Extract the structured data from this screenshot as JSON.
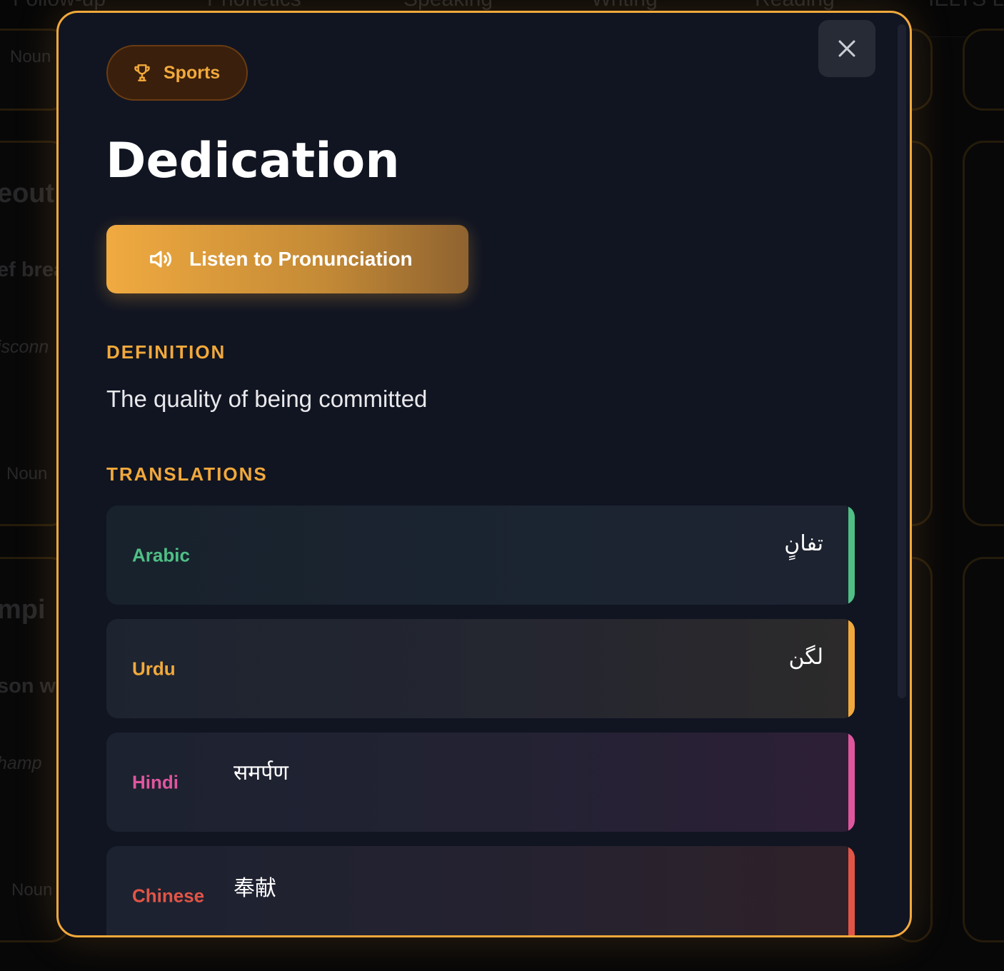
{
  "background": {
    "nav_items": [
      "Follow-up",
      "Phonetics",
      "Speaking",
      "Writing",
      "Reading",
      "IELTS L"
    ],
    "fragments": [
      "Noun",
      "eout",
      "ef brea",
      "isconn",
      "Noun",
      "mpi",
      "son w",
      "hamp",
      "Noun"
    ]
  },
  "modal": {
    "category_badge": {
      "label": "Sports",
      "icon": "trophy-icon"
    },
    "close_icon": "close-icon",
    "word": "Dedication",
    "listen_button": {
      "label": "Listen to Pronunciation",
      "icon": "speaker-icon"
    },
    "definition_heading": "DEFINITION",
    "definition": "The quality of being committed",
    "translations_heading": "TRANSLATIONS",
    "translations": [
      {
        "language": "Arabic",
        "value": "تفانٍ",
        "color": "#4fbf86"
      },
      {
        "language": "Urdu",
        "value": "لگن",
        "color": "#f2a93b"
      },
      {
        "language": "Hindi",
        "value": "समर्पण",
        "color": "#e0569e"
      },
      {
        "language": "Chinese",
        "value": "奉献",
        "color": "#e25546"
      }
    ]
  },
  "colors": {
    "accent": "#f2a93b",
    "modal_bg": "#111522"
  }
}
